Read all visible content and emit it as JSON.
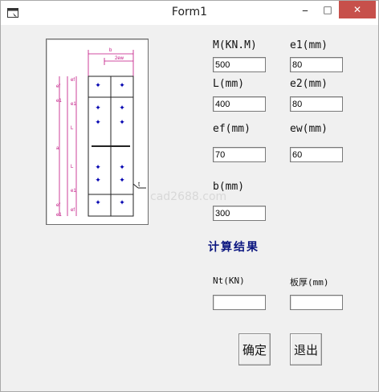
{
  "window": {
    "title": "Form1"
  },
  "titlebar": {
    "minimize": "–",
    "maximize": "□",
    "close": "✕"
  },
  "inputs": {
    "M": {
      "label": "M(KN.M)",
      "value": "500"
    },
    "e1": {
      "label": "e1(mm)",
      "value": "80"
    },
    "L": {
      "label": "L(mm)",
      "value": "400"
    },
    "e2": {
      "label": "e2(mm)",
      "value": "80"
    },
    "ef": {
      "label": "ef(mm)",
      "value": "70"
    },
    "ew": {
      "label": "ew(mm)",
      "value": "60"
    },
    "b": {
      "label": "b(mm)",
      "value": "300"
    }
  },
  "results": {
    "title": "计算结果",
    "Nt": {
      "label": "Nt(KN)",
      "value": ""
    },
    "thickness": {
      "label": "板厚(mm)",
      "value": ""
    }
  },
  "buttons": {
    "ok": "确定",
    "exit": "退出"
  },
  "watermark": "cad2688.com",
  "diagram": {
    "top_dims": [
      "b",
      "2ew"
    ],
    "left_dims": [
      "ef",
      "e1",
      "L",
      "a",
      "L",
      "e1",
      "ef"
    ],
    "outer_dims": [
      "ef",
      "e1",
      "ef",
      "e1"
    ],
    "callout": "t"
  },
  "colors": {
    "dim": "#c01080",
    "bolt": "#0000b0",
    "title": "#0b1680",
    "close": "#c7504b"
  }
}
